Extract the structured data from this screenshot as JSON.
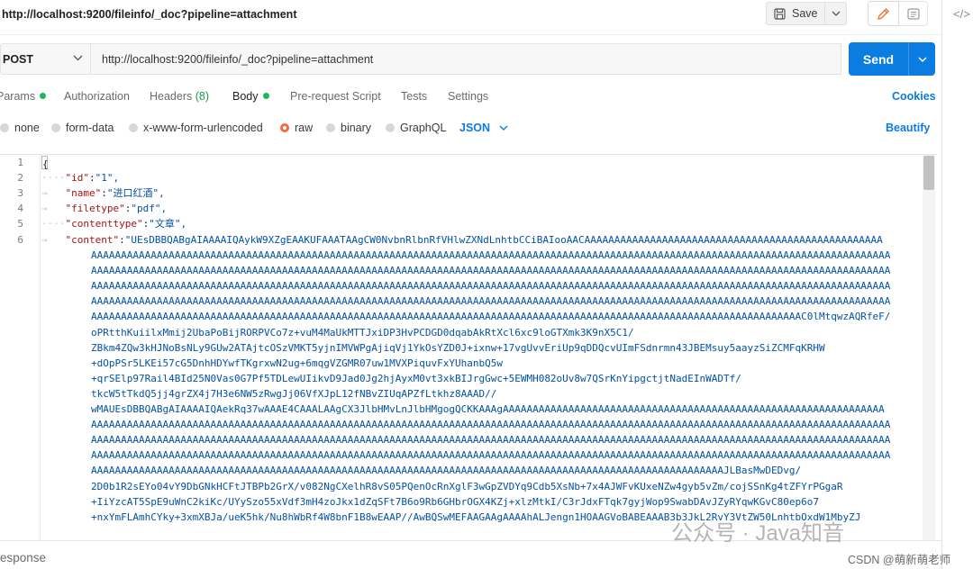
{
  "request": {
    "title": "http://localhost:9200/fileinfo/_doc?pipeline=attachment",
    "method": "POST",
    "url": "http://localhost:9200/fileinfo/_doc?pipeline=attachment"
  },
  "toolbar": {
    "save_label": "Save",
    "send_label": "Send"
  },
  "tabs": [
    {
      "label": "Params",
      "dot": true
    },
    {
      "label": "Authorization"
    },
    {
      "label": "Headers",
      "count": "(8)"
    },
    {
      "label": "Body",
      "dot": true,
      "active": true
    },
    {
      "label": "Pre-request Script"
    },
    {
      "label": "Tests"
    },
    {
      "label": "Settings"
    }
  ],
  "cookies_label": "Cookies",
  "body_types": [
    {
      "label": "none"
    },
    {
      "label": "form-data"
    },
    {
      "label": "x-www-form-urlencoded"
    },
    {
      "label": "raw",
      "selected": true
    },
    {
      "label": "binary"
    },
    {
      "label": "GraphQL"
    }
  ],
  "raw_format": "JSON",
  "beautify_label": "Beautify",
  "editor": {
    "line_numbers": [
      "1",
      "2",
      "3",
      "4",
      "5",
      "6"
    ],
    "open_brace": "{",
    "fields": [
      {
        "key": "\"id\"",
        "value": "\"1\","
      },
      {
        "key": "\"name\"",
        "value": "\"进口红酒\","
      },
      {
        "key": "\"filetype\"",
        "value": "\"pdf\","
      },
      {
        "key": "\"contenttype\"",
        "value": "\"文章\","
      }
    ],
    "content_key": "\"content\"",
    "content_lines": [
      "\"UEsDBBQABgAIAAAAIQAykW9XZgEAAKUFAAATAAgCW0NvbnRlbnRfVHlwZXNdLnhtbCCiBAIooAACAAAAAAAAAAAAAAAAAAAAAAAAAAAAAAAAAAAAAAAAAAAAAAAAAA",
      "AAAAAAAAAAAAAAAAAAAAAAAAAAAAAAAAAAAAAAAAAAAAAAAAAAAAAAAAAAAAAAAAAAAAAAAAAAAAAAAAAAAAAAAAAAAAAAAAAAAAAAAAAAAAAAAAAAAAAAAAAAAAAAAAAAAAAA",
      "AAAAAAAAAAAAAAAAAAAAAAAAAAAAAAAAAAAAAAAAAAAAAAAAAAAAAAAAAAAAAAAAAAAAAAAAAAAAAAAAAAAAAAAAAAAAAAAAAAAAAAAAAAAAAAAAAAAAAAAAAAAAAAAAAAAAAA",
      "AAAAAAAAAAAAAAAAAAAAAAAAAAAAAAAAAAAAAAAAAAAAAAAAAAAAAAAAAAAAAAAAAAAAAAAAAAAAAAAAAAAAAAAAAAAAAAAAAAAAAAAAAAAAAAAAAAAAAAAAAAAAAAAAAAAAAA",
      "AAAAAAAAAAAAAAAAAAAAAAAAAAAAAAAAAAAAAAAAAAAAAAAAAAAAAAAAAAAAAAAAAAAAAAAAAAAAAAAAAAAAAAAAAAAAAAAAAAAAAAAAAAAAAAAAAAAAAAAAAAAAAAAAAAAAAA",
      "AAAAAAAAAAAAAAAAAAAAAAAAAAAAAAAAAAAAAAAAAAAAAAAAAAAAAAAAAAAAAAAAAAAAAAAAAAAAAAAAAAAAAAAAAAAAAAAAAAAAAAAAAAAAAAAAAAAAAAAC0lMtqwzAQRfeF/",
      "oPRtthKuiilxMmij2UbaPoBijRORPVCo7z+vuM4MaUkMTTJxiDP3HvPCDGD0dqabAkRtXcl6xc9loGTXmk3K9nX5C1/",
      "ZBkm4ZQw3kHJNoBsNLy9GUw2ATAjtcOSzVMKT5yjnIMVWPgAjiqVj1YkOsYZD0J+ixnw+17vgUvvEriUp9qDDQcvUImFSdnrmn43JBEMsuy5aayzSiZCMFqKRHW",
      "+dOpPSr5LKEi57cG5DnhHDYwfTKgrxwN2ug+6mqgVZGMR07uw1MVXPiquvFxYUhanbQ5w",
      "+qrSElp97Rail4BId25N0Vas0G7Pf5TDLewUIikvD9Jad0Jg2hjAyxM0vt3xkBIJrgGwc+5EWMH082oUv8w7QSrKnYipgctjtNadEInWADTf/",
      "tkcW5tTkdQ5jj4grZX4j7H3e6NW5zRwgJj06VfXJpL12fNBvZIUqAPZfLtkhz8AAAD//",
      "wMAUEsDBBQABgAIAAAAIQAekRq37wAAAE4CAAALAAgCX3JlbHMvLnJlbHMgogQCKKAAAgAAAAAAAAAAAAAAAAAAAAAAAAAAAAAAAAAAAAAAAAAAAAAAAAAAAAAAAAAAAAAAAA",
      "AAAAAAAAAAAAAAAAAAAAAAAAAAAAAAAAAAAAAAAAAAAAAAAAAAAAAAAAAAAAAAAAAAAAAAAAAAAAAAAAAAAAAAAAAAAAAAAAAAAAAAAAAAAAAAAAAAAAAAAAAAAAAAAAAAAAAA",
      "AAAAAAAAAAAAAAAAAAAAAAAAAAAAAAAAAAAAAAAAAAAAAAAAAAAAAAAAAAAAAAAAAAAAAAAAAAAAAAAAAAAAAAAAAAAAAAAAAAAAAAAAAAAAAAAAAAAAAAAAAAAAAAAAAAAAAA",
      "AAAAAAAAAAAAAAAAAAAAAAAAAAAAAAAAAAAAAAAAAAAAAAAAAAAAAAAAAAAAAAAAAAAAAAAAAAAAAAAAAAAAAAAAAAAAAAAAAAAAAAAAAAAAAAAAAAAAAAAAAAAAAAAAAAAAAA",
      "AAAAAAAAAAAAAAAAAAAAAAAAAAAAAAAAAAAAAAAAAAAAAAAAAAAAAAAAAAAAAAAAAAAAAAAAAAAAAAAAAAAAAAAAAAAAAAAAAAAAAAAAAAJLBasMwDEDvg/",
      "2D0b1R2sEYo04vY9DbGNkHCFtJTBPb2GrX/v082NgCXelhR8vS05PQenOcRnXglF3wGpZVDYq9Cdb5XsNb+7x4AJWFvKUxeNZw4gyb5vZm/cojSSnKg4tZFYrPGgaR",
      "+IiYzcAT5SpE9uWnC2kiKc/UYySzo55xVdf3mH4zoJkx1dZqSFt7B6o9Rb6GHbrOGX4KZj+xlzMtkI/C3rJdxFTqk7gyjWop9SwabDAvJZyRYqwKGvC80ep6o7",
      "+nxYmFLAmhCYky+3xmXBJa/ueK5hk/Nu8hWbRf4W8bnF1B8wEAAP//AwBQSwMEFAAGAAgAAAAhALJengn1HOAAGVoBABEAAAB3b3JkL2RvY3VtZW50LnhtbOxdW1MbyZJ"
    ]
  },
  "response_label": "esponse",
  "watermark_text": "公众号 · Java知音",
  "credit_text": "CSDN @萌新萌老师",
  "colors": {
    "accent": "#0b7ce0",
    "active_dot": "#1fb55a",
    "raw_radio": "#f26b3a"
  }
}
